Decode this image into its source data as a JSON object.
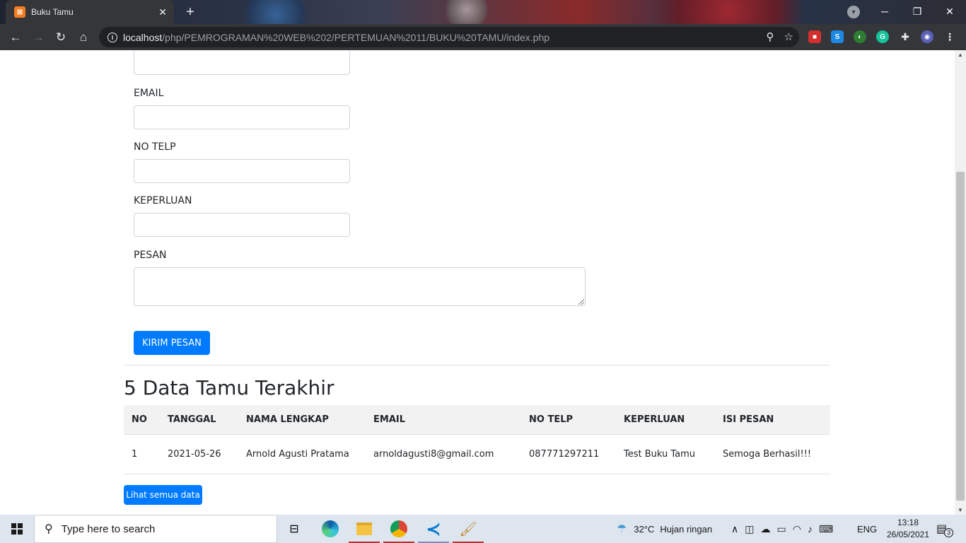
{
  "browser": {
    "tab_title": "Buku Tamu",
    "url_host": "localhost",
    "url_path": "/php/PEMROGRAMAN%20WEB%202/PERTEMUAN%2011/BUKU%20TAMU/index.php",
    "new_tab_symbol": "+",
    "tab_close_symbol": "✕"
  },
  "form": {
    "email_label": "EMAIL",
    "phone_label": "NO TELP",
    "purpose_label": "KEPERLUAN",
    "message_label": "PESAN",
    "submit_label": "KIRIM PESAN"
  },
  "recent": {
    "heading": "5 Data Tamu Terakhir",
    "columns": [
      "NO",
      "TANGGAL",
      "NAMA LENGKAP",
      "EMAIL",
      "NO TELP",
      "KEPERLUAN",
      "ISI PESAN"
    ],
    "rows": [
      [
        "1",
        "2021-05-26",
        "Arnold Agusti Pratama",
        "arnoldagusti8@gmail.com",
        "087771297211",
        "Test Buku Tamu",
        "Semoga Berhasil!!!"
      ]
    ],
    "view_all_label": "Lihat semua data"
  },
  "taskbar": {
    "search_placeholder": "Type here to search",
    "weather_temp": "32°C",
    "weather_desc": "Hujan ringan",
    "language": "ENG",
    "time": "13:18",
    "date": "26/05/2021",
    "notification_count": "3"
  },
  "colors": {
    "primary": "#007bff",
    "chrome_dark": "#35363a"
  }
}
